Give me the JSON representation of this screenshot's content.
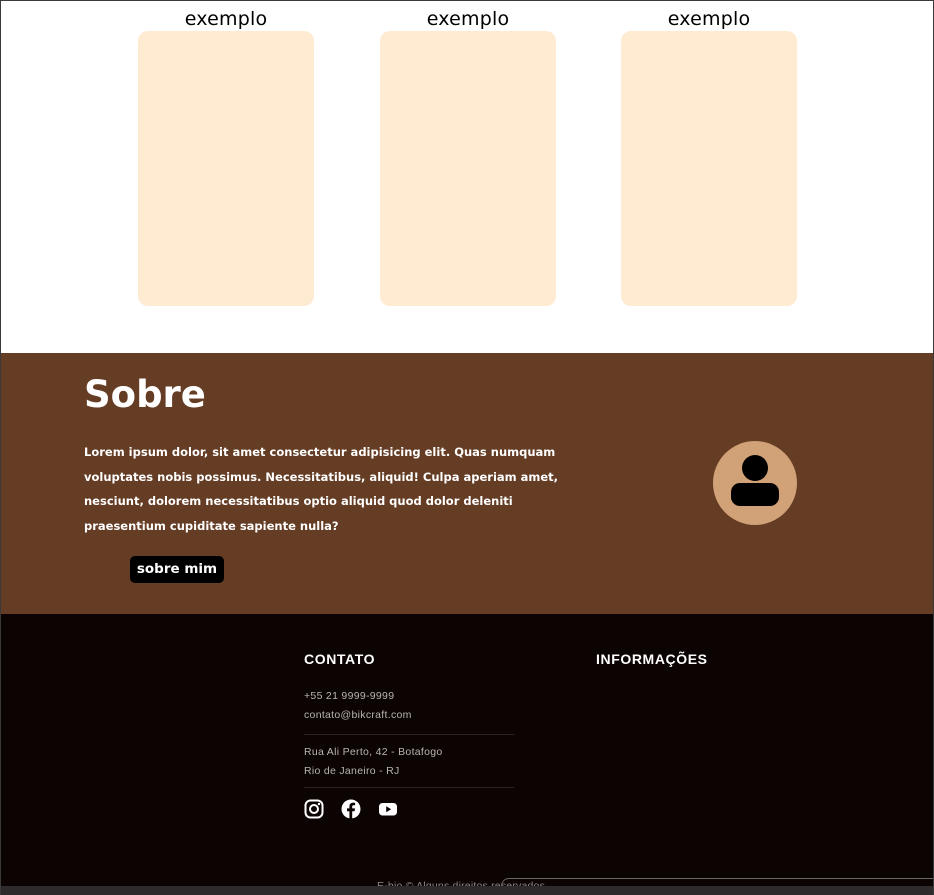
{
  "cards": [
    {
      "label": "exemplo"
    },
    {
      "label": "exemplo"
    },
    {
      "label": "exemplo"
    }
  ],
  "sobre": {
    "title": "Sobre",
    "text": "Lorem ipsum dolor, sit amet consectetur adipisicing elit. Quas numquam voluptates nobis possimus. Necessitatibus, aliquid! Culpa aperiam amet, nesciunt, dolorem necessitatibus optio aliquid quod dolor deleniti praesentium cupiditate sapiente nulla?",
    "button_label": "sobre mim",
    "avatar_icon": "user-icon"
  },
  "footer": {
    "contato": {
      "heading": "CONTATO",
      "phone": "+55 21 9999-9999",
      "email": "contato@bikcraft.com",
      "address_line1": "Rua Ali Perto, 42 - Botafogo",
      "address_line2": "Rio de Janeiro - RJ"
    },
    "informacoes": {
      "heading": "INFORMAÇÕES"
    },
    "social": [
      {
        "icon": "instagram-icon"
      },
      {
        "icon": "facebook-icon"
      },
      {
        "icon": "youtube-icon"
      }
    ],
    "copyright": "E-bio © Alguns direitos reservados."
  },
  "colors": {
    "card": "#feebd2",
    "sobre_bg": "#653c24",
    "avatar": "#d1a277",
    "footer_bg": "#0c0403"
  }
}
